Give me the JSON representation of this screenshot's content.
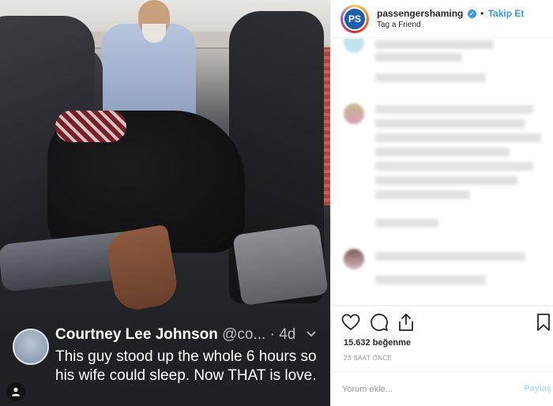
{
  "post": {
    "username": "passengershaming",
    "verified_icon": "verified-badge-icon",
    "separator": "•",
    "follow_label": "Takip Et",
    "location": "Tag a Friend",
    "avatar_text": "PS"
  },
  "tweet": {
    "author_name": "Courtney Lee Johnson",
    "author_handle": "@co...",
    "time_sep": "·",
    "age": "4d",
    "text": "This guy stood up the whole 6 hours so his wife could sleep. Now THAT is love."
  },
  "stats": {
    "likes": "15.632 beğenme",
    "time": "23 SAAT ÖNCE"
  },
  "comment_box": {
    "placeholder": "Yorum ekle...",
    "post_label": "Paylaş"
  },
  "colors": {
    "accent": "#3897f0",
    "post_disabled": "#b2dffc"
  }
}
